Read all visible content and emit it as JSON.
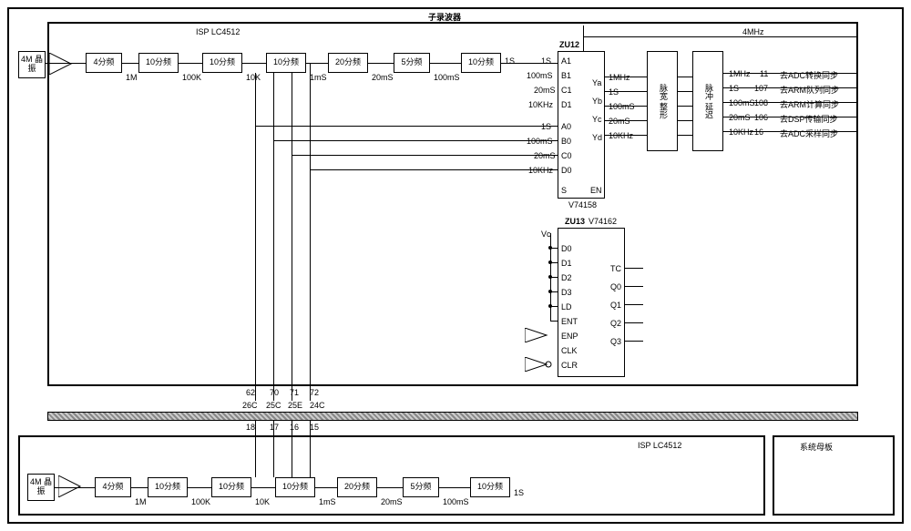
{
  "title_top": "子录波器",
  "isp_top": "ISP  LC4512",
  "freq_external": "4MHz",
  "crystal": "4M 晶振",
  "dividers": [
    "4分频",
    "10分频",
    "10分频",
    "10分频",
    "20分频",
    "5分频",
    "10分频"
  ],
  "freqs": [
    "1M",
    "100K",
    "10K",
    "1mS",
    "20mS",
    "100mS",
    "1S"
  ],
  "zu12": "ZU12",
  "mux_inputs_a": [
    "A1",
    "B1",
    "C1",
    "D1",
    "A0",
    "B0",
    "C0",
    "D0"
  ],
  "mux_signals_a": [
    "1S",
    "100mS",
    "20mS",
    "10KHz",
    "1S",
    "100mS",
    "20mS",
    "10KHz"
  ],
  "mux_y": [
    "Ya",
    "Yb",
    "Yc",
    "Yd"
  ],
  "mux_yv": [
    "1MHz",
    "1S",
    "100mS",
    "20mS",
    "10KHz"
  ],
  "mux_se": [
    "S",
    "EN"
  ],
  "mux_part": "V74158",
  "block_shape": "脉宽 整形",
  "block_delay": "脉冲 延迟",
  "outputs": [
    {
      "sig": "1MHz",
      "pin": "11",
      "dest": "去ADC转换同步"
    },
    {
      "sig": "1S",
      "pin": "107",
      "dest": "去ARM队列同步"
    },
    {
      "sig": "100mS",
      "pin": "108",
      "dest": "去ARM计算同步"
    },
    {
      "sig": "20mS",
      "pin": "106",
      "dest": "去DSP传输同步"
    },
    {
      "sig": "10KHz",
      "pin": "16",
      "dest": "去ADC采样同步"
    }
  ],
  "zu13": "ZU13",
  "zu13_part": "V74162",
  "zu13_left": [
    "Vc",
    "D0",
    "D1",
    "D2",
    "D3",
    "LD",
    "ENT",
    "ENP",
    "CLK",
    "CLR"
  ],
  "zu13_right": [
    "TC",
    "Q0",
    "Q1",
    "Q2",
    "Q3"
  ],
  "bus_top": [
    "62",
    "70",
    "71",
    "72"
  ],
  "bus_mid": [
    "26C",
    "25C",
    "25E",
    "24C"
  ],
  "bus_bot": [
    "18",
    "17",
    "16",
    "15"
  ],
  "isp_bot": "ISP  LC4512",
  "mother": "系统母板"
}
